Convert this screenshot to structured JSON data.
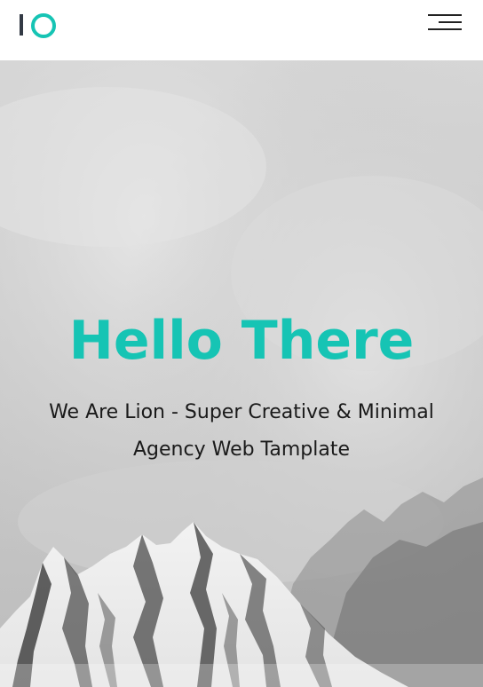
{
  "header": {
    "logo_icon": "lion-logo-icon",
    "menu_icon": "hamburger-menu-icon"
  },
  "hero": {
    "title": "Hello There",
    "subtitle": "We Are Lion - Super Creative & Minimal Agency Web Tamplate",
    "background": "snowy-mountain-fog-image"
  },
  "colors": {
    "accent": "#16c4b4",
    "logo_dark": "#333a45",
    "text_dark": "#1a1a1a"
  }
}
